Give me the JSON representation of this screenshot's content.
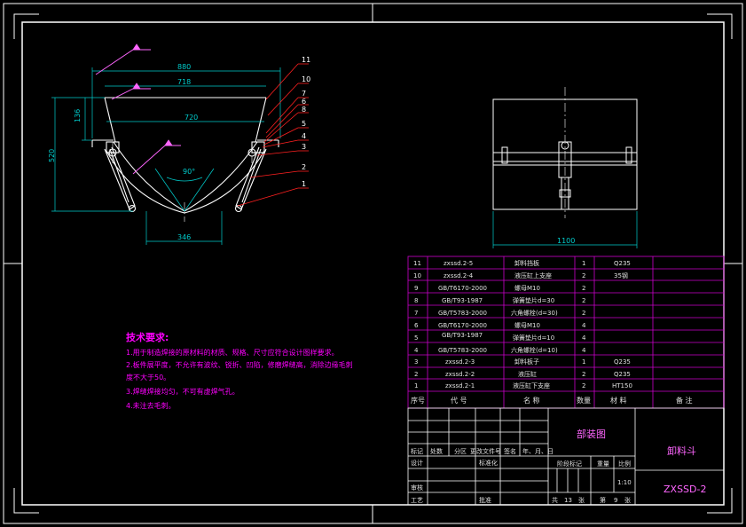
{
  "colors": {
    "background": "#000000",
    "frame": "#ffffff",
    "dimension": "#00cccc",
    "leader": "#ff2020",
    "table": "#cc00cc",
    "weld": "#ff66ff",
    "notes": "#ff00ff",
    "text": "#e0e0e0",
    "title": "#ff66ff"
  },
  "front_view": {
    "dims": {
      "top_width": "880",
      "mid_width": "718",
      "lower_width": "720",
      "bottom_width": "346",
      "height_small": "136",
      "height_total": "520",
      "angle": "90°"
    },
    "balloons": [
      "11",
      "10",
      "7",
      "6",
      "8",
      "5",
      "4",
      "3",
      "2",
      "1"
    ]
  },
  "side_view": {
    "dims": {
      "width": "1100"
    }
  },
  "notes": {
    "title": "技术要求:",
    "lines": [
      "1.用于制造焊接的原材料的材质、规格、尺寸应符合设计图样要求。",
      "2.板件展平度，不允许有波纹、锐折、凹陷，修磨焊缝高，消除边缘毛刺",
      "度不大于50。",
      "3.焊缝焊接均匀，不可有虚焊气孔。",
      "4.未注去毛刺。"
    ]
  },
  "parts_list": {
    "rows": [
      {
        "no": "11",
        "code": "zxssd.2-5",
        "name": "卸料挡板",
        "qty": "1",
        "material": "Q235",
        "remark": ""
      },
      {
        "no": "10",
        "code": "zxssd.2-4",
        "name": "液压缸上支座",
        "qty": "2",
        "material": "35钢",
        "remark": ""
      },
      {
        "no": "9",
        "code": "GB/T6170-2000",
        "name": "螺母M10",
        "qty": "2",
        "material": "",
        "remark": ""
      },
      {
        "no": "8",
        "code": "GB/T93-1987",
        "name": "弹簧垫片d=30",
        "qty": "2",
        "material": "",
        "remark": ""
      },
      {
        "no": "7",
        "code": "GB/T5783-2000",
        "name": "六角螺栓(d=30)",
        "qty": "2",
        "material": "",
        "remark": ""
      },
      {
        "no": "6",
        "code": "GB/T6170-2000",
        "name": "螺母M10",
        "qty": "4",
        "material": "",
        "remark": ""
      },
      {
        "no": "5",
        "code": "GB/T93-1987",
        "name": "弹簧垫片d=10",
        "qty": "4",
        "material": "",
        "remark": ""
      },
      {
        "no": "4",
        "code": "GB/T5783-2000",
        "name": "六角螺栓(d=10)",
        "qty": "4",
        "material": "",
        "remark": ""
      },
      {
        "no": "3",
        "code": "zxssd.2-3",
        "name": "卸料板子",
        "qty": "1",
        "material": "Q235",
        "remark": ""
      },
      {
        "no": "2",
        "code": "zxssd.2-2",
        "name": "液压缸",
        "qty": "2",
        "material": "Q235",
        "remark": ""
      },
      {
        "no": "1",
        "code": "zxssd.2-1",
        "name": "液压缸下支座",
        "qty": "2",
        "material": "HT150",
        "remark": ""
      }
    ],
    "header": {
      "no": "序号",
      "code": "代  号",
      "name": "名  称",
      "qty": "数量",
      "material": "材  料",
      "remark": "备  注"
    }
  },
  "title_block": {
    "drawing_type": "部装图",
    "part_name": "卸料斗",
    "drawing_no": "ZXSSD-2",
    "labels": {
      "mark": "标记",
      "count": "处数",
      "zone": "分区",
      "change_no": "更改文件号",
      "signature": "签名",
      "date": "年、月、日",
      "design": "设计",
      "standardize": "标准化",
      "stage_mark": "阶段标记",
      "weight": "重量",
      "scale": "比例",
      "review": "审核",
      "process": "工艺",
      "approve": "批准",
      "total": "共",
      "sheets": "张",
      "sheet_no": "第",
      "sheet_no_unit": "张"
    },
    "scale_value": "1:10",
    "total_sheets": "13",
    "sheet_number": "9"
  }
}
